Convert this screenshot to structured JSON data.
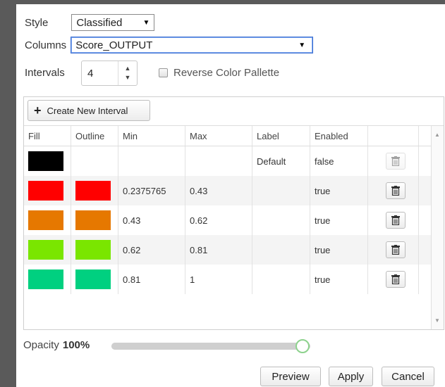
{
  "style": {
    "label": "Style",
    "value": "Classified"
  },
  "columns": {
    "label": "Columns",
    "value": "Score_OUTPUT"
  },
  "intervals": {
    "label": "Intervals",
    "value": "4"
  },
  "reverse": {
    "label": "Reverse Color Pallette",
    "checked": false
  },
  "toolbar": {
    "create_label": "Create New Interval"
  },
  "table": {
    "headers": {
      "fill": "Fill",
      "outline": "Outline",
      "min": "Min",
      "max": "Max",
      "label": "Label",
      "enabled": "Enabled"
    },
    "rows": [
      {
        "fill": "#000000",
        "outline": "",
        "min": "",
        "max": "",
        "label": "Default",
        "enabled": "false",
        "delete_enabled": false
      },
      {
        "fill": "#ff0000",
        "outline": "#ff0000",
        "min": "0.2375765",
        "max": "0.43",
        "label": "",
        "enabled": "true",
        "delete_enabled": true
      },
      {
        "fill": "#e67800",
        "outline": "#e67800",
        "min": "0.43",
        "max": "0.62",
        "label": "",
        "enabled": "true",
        "delete_enabled": true
      },
      {
        "fill": "#7ae600",
        "outline": "#7ae600",
        "min": "0.62",
        "max": "0.81",
        "label": "",
        "enabled": "true",
        "delete_enabled": true
      },
      {
        "fill": "#00d080",
        "outline": "#00d080",
        "min": "0.81",
        "max": "1",
        "label": "",
        "enabled": "true",
        "delete_enabled": true
      }
    ]
  },
  "opacity": {
    "label": "Opacity",
    "value": "100%",
    "fraction": 1.0
  },
  "footer": {
    "preview": "Preview",
    "apply": "Apply",
    "cancel": "Cancel"
  },
  "icons": {
    "trash": "trash-icon",
    "plus": "plus-icon"
  }
}
